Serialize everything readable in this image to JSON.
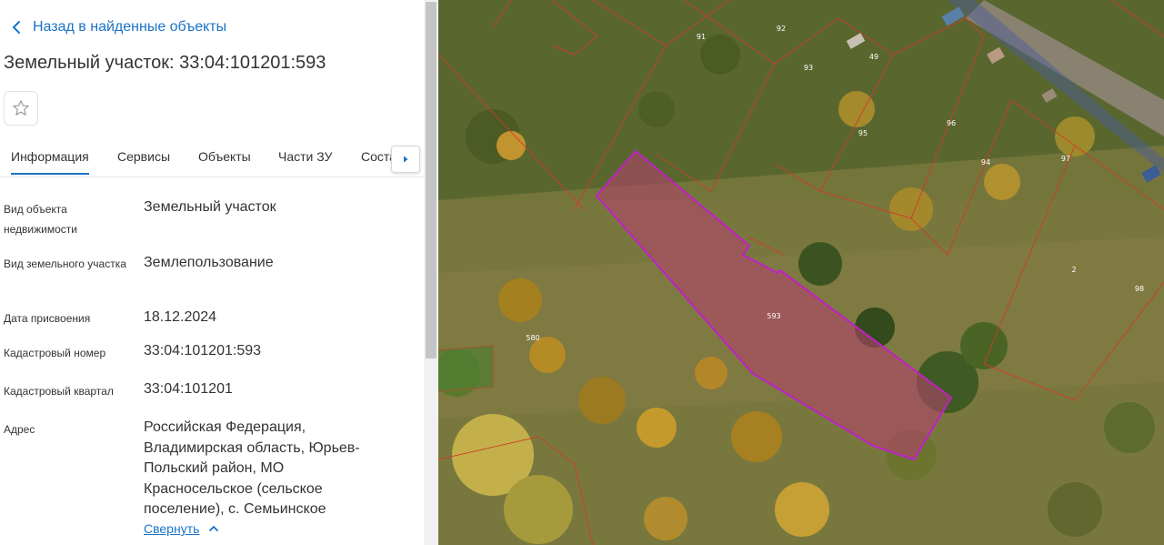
{
  "panel": {
    "back_label": "Назад в найденные объекты",
    "title": "Земельный участок: 33:04:101201:593",
    "tabs": [
      {
        "label": "Информация",
        "active": true
      },
      {
        "label": "Сервисы"
      },
      {
        "label": "Объекты"
      },
      {
        "label": "Части ЗУ"
      },
      {
        "label": "Соста"
      }
    ],
    "fields": [
      {
        "label": "Вид объекта недвижимости",
        "value": "Земельный участок"
      },
      {
        "label": "Вид земельного участка",
        "value": "Землепользование"
      },
      {
        "label": "Дата присвоения",
        "value": "18.12.2024"
      },
      {
        "label": "Кадастровый номер",
        "value": "33:04:101201:593"
      },
      {
        "label": "Кадастровый квартал",
        "value": "33:04:101201"
      },
      {
        "label": "Адрес",
        "value": "Российская Федерация, Владимирская область, Юрьев-Польский район, МО Красносельское (сельское поселение), с. Семьинское"
      }
    ],
    "collapse_label": "Свернуть",
    "icons": {
      "back": "chevron-left-icon",
      "favorite": "star-icon",
      "tabs_next": "arrow-right-icon",
      "collapse": "chevron-up-icon"
    }
  },
  "map": {
    "parcel_labels": [
      "91",
      "92",
      "93",
      "49",
      "95",
      "96",
      "94",
      "97",
      "2",
      "98",
      "593",
      "580"
    ],
    "selected_parcel": "593",
    "colors": {
      "selected_fill": "#b0426a",
      "selected_stroke": "#c020c8",
      "boundary": "#d23a2a",
      "accent": "#1a73c8"
    }
  }
}
